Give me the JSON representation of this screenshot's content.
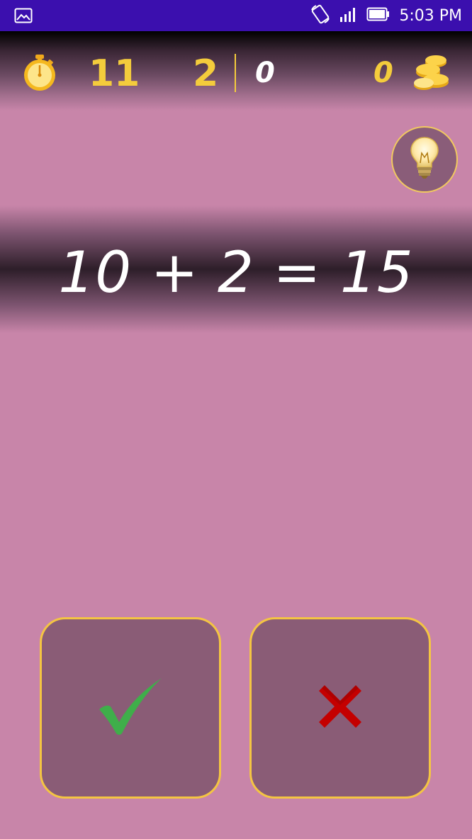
{
  "status_bar": {
    "time": "5:03 PM",
    "icons": [
      "gallery-icon",
      "rotate-icon",
      "signal-icon",
      "battery-icon"
    ]
  },
  "hud": {
    "time_left": "11",
    "level": "2",
    "score": "0",
    "coins": "0",
    "icons": [
      "stopwatch-icon",
      "coins-icon"
    ]
  },
  "hint": {
    "icon": "lightbulb-icon"
  },
  "equation": "10 + 2 = 15",
  "answers": {
    "true_icon": "checkmark-icon",
    "false_icon": "cross-icon"
  },
  "colors": {
    "background": "#c885a9",
    "status_bar": "#3b0fae",
    "accent_gold": "#f4cc3c",
    "button_fill": "#8a5c76",
    "check_green": "#3fae4a",
    "cross_red": "#c40000"
  }
}
